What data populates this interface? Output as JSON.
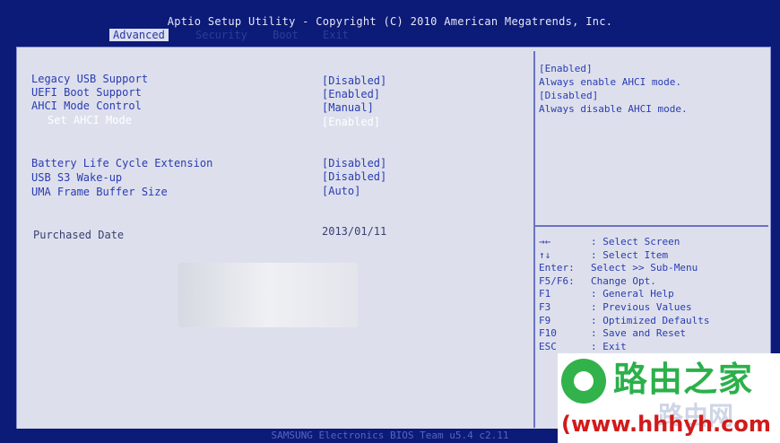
{
  "header": {
    "title": "Aptio Setup Utility - Copyright (C) 2010 American Megatrends, Inc."
  },
  "menu": {
    "tabs": [
      {
        "label": "Advanced"
      },
      {
        "label": "Security"
      },
      {
        "label": "Boot"
      },
      {
        "label": "Exit"
      }
    ]
  },
  "settings": [
    {
      "label": "Legacy USB Support",
      "value": "[Disabled]"
    },
    {
      "label": "UEFI Boot Support",
      "value": "[Enabled]"
    },
    {
      "label": "AHCI Mode Control",
      "value": "[Manual]"
    },
    {
      "label": "Set AHCI Mode",
      "value": "[Enabled]"
    },
    {
      "label": "Battery Life Cycle Extension",
      "value": "[Disabled]"
    },
    {
      "label": "USB S3 Wake-up",
      "value": "[Disabled]"
    },
    {
      "label": "UMA Frame Buffer Size",
      "value": "[Auto]"
    },
    {
      "label": "Purchased Date",
      "value": "2013/01/11"
    }
  ],
  "help": {
    "lines": [
      "[Enabled]",
      "Always enable AHCI mode.",
      "[Disabled]",
      "Always disable AHCI mode."
    ]
  },
  "keys": [
    {
      "key": "→←",
      "desc": ": Select Screen"
    },
    {
      "key": "↑↓",
      "desc": ": Select Item"
    },
    {
      "key": "Enter:",
      "desc": "Select >> Sub-Menu"
    },
    {
      "key": "F5/F6:",
      "desc": "Change Opt."
    },
    {
      "key": "F1",
      "desc": ": General Help"
    },
    {
      "key": "F3",
      "desc": ": Previous Values"
    },
    {
      "key": "F9",
      "desc": ": Optimized Defaults"
    },
    {
      "key": "F10",
      "desc": ": Save and Reset"
    },
    {
      "key": "ESC",
      "desc": ": Exit"
    }
  ],
  "footer": {
    "text": "SAMSUNG Electronics BIOS Team u5.4 c2.11"
  },
  "watermark": {
    "name": "路由之家",
    "url": "(www.hhhyh.com",
    "ghost": "路由网"
  },
  "colors": {
    "bios_blue": "#0c1a78",
    "panel": "#dde0ec",
    "text_blue": "#2a3bb2",
    "watermark_green": "#2bb04a",
    "watermark_red": "#d21a1a"
  }
}
